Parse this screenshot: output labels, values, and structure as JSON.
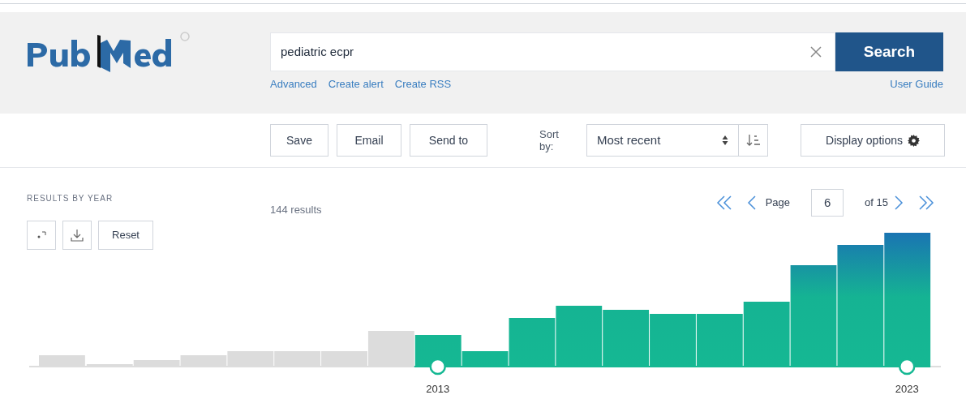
{
  "header": {
    "search": {
      "value": "pediatric ecpr",
      "button": "Search"
    },
    "links": [
      "Advanced",
      "Create alert",
      "Create RSS"
    ],
    "user_guide": "User Guide"
  },
  "toolbar": {
    "buttons": [
      "Save",
      "Email",
      "Send to"
    ],
    "sort_label": "Sort by:",
    "sort_value": "Most recent",
    "display_options": "Display options"
  },
  "results_by_year": {
    "title": "RESULTS BY YEAR",
    "reset": "Reset",
    "range_start": "2013",
    "range_end": "2023"
  },
  "results_count": "144 results",
  "pagination": {
    "label": "Page",
    "page": "6",
    "of": "of 15"
  }
}
